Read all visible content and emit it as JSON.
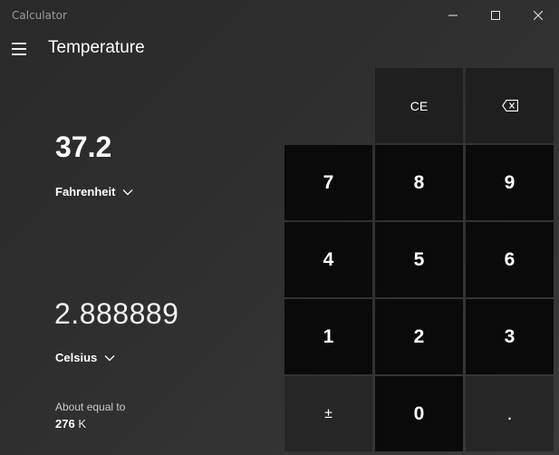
{
  "window": {
    "title": "Calculator"
  },
  "header": {
    "mode_title": "Temperature"
  },
  "converter": {
    "from": {
      "value": "37.2",
      "unit": "Fahrenheit"
    },
    "to": {
      "value": "2.888889",
      "unit": "Celsius"
    },
    "about": {
      "label": "About equal to",
      "value": "276",
      "unit": "K"
    }
  },
  "keypad": {
    "ce": "CE",
    "seven": "7",
    "eight": "8",
    "nine": "9",
    "four": "4",
    "five": "5",
    "six": "6",
    "one": "1",
    "two": "2",
    "three": "3",
    "plus_minus": "±",
    "zero": "0",
    "decimal": "."
  },
  "icons": {
    "menu": "hamburger-menu-icon",
    "minimize": "minimize-icon",
    "maximize": "maximize-icon",
    "close": "close-icon",
    "backspace": "backspace-icon",
    "dropdown": "chevron-down-icon"
  },
  "colors": {
    "number_key": "#0a0a0a",
    "operator_key": "#1f1f1f",
    "background": "#2b2b2b",
    "text": "#ffffff"
  }
}
